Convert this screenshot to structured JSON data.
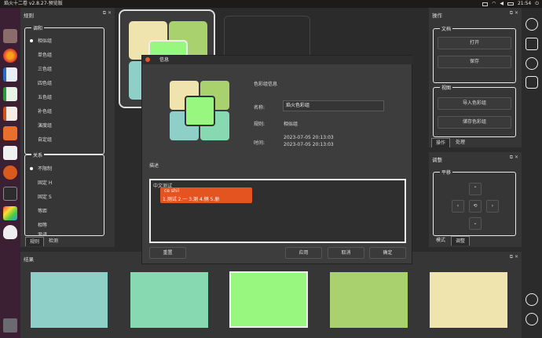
{
  "topbar": {
    "title": "焰火十二卷 v2.8.27-预览版",
    "time": "21:54"
  },
  "launcher": {
    "icons": [
      "files-icon",
      "firefox-icon",
      "writer-icon",
      "calc-icon",
      "impress-icon",
      "software-center-icon",
      "amazon-icon",
      "settings-icon",
      "terminal-icon",
      "colors-icon",
      "linux-icon",
      "trash-icon"
    ]
  },
  "left_panel": {
    "title": "规则",
    "group_harmony": {
      "label": "调和",
      "options": [
        "相似组",
        "单色组",
        "三色组",
        "四色组",
        "五色组",
        "补色组",
        "演度组",
        "自定组"
      ],
      "selected": 0
    },
    "group_relation": {
      "label": "关系",
      "options": [
        "不限制",
        "固定 H",
        "固定 S",
        "等距",
        "相等",
        "渐进"
      ],
      "selected": 0
    },
    "tabs": [
      "规则",
      "检测"
    ]
  },
  "right_panel": {
    "title": "操作",
    "file_group": {
      "label": "文档",
      "buttons": [
        "打开",
        "保存"
      ]
    },
    "view_group": {
      "label": "视图",
      "buttons": [
        "导入色彩组",
        "储存色彩组"
      ]
    },
    "tabs": [
      "操作",
      "处理"
    ]
  },
  "adjust_panel": {
    "title": "调整",
    "group": "平移",
    "tabs": [
      "模式",
      "调整"
    ]
  },
  "results_panel": {
    "title": "结果",
    "colors": [
      "#8ecfc7",
      "#86d9b1",
      "#98f77e",
      "#a9d26e",
      "#efe4ae"
    ]
  },
  "canvas": {
    "palette": [
      "#efe4ae",
      "#a9d26e",
      "#98f77e",
      "#8ecfc7",
      "#86d9b1"
    ]
  },
  "dialog": {
    "title": "信息",
    "section_title": "色彩组信息",
    "name_label": "名称:",
    "name_value": "焰火色彩组",
    "rule_label": "规则:",
    "rule_value": "相似组",
    "time_label": "时间:",
    "time_created": "2023-07-05 20:13:03",
    "time_modified": "2023-07-05 20:13:03",
    "desc_label": "描述",
    "desc_text": "中文测试",
    "ime_input": "ce shil",
    "ime_candidates": "1.测试 2.一 3.测 4.侧 5.册",
    "buttons": {
      "reset": "重置",
      "apply": "应用",
      "cancel": "取消",
      "ok": "确定"
    }
  }
}
